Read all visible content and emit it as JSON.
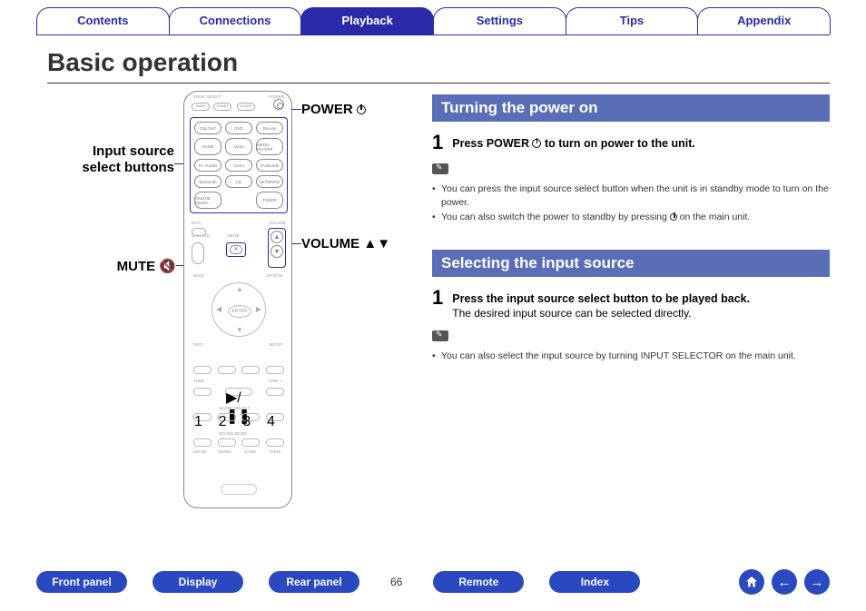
{
  "topnav": {
    "tabs": [
      {
        "label": "Contents",
        "active": false
      },
      {
        "label": "Connections",
        "active": false
      },
      {
        "label": "Playback",
        "active": true
      },
      {
        "label": "Settings",
        "active": false
      },
      {
        "label": "Tips",
        "active": false
      },
      {
        "label": "Appendix",
        "active": false
      }
    ]
  },
  "page": {
    "title": "Basic operation",
    "number": "66"
  },
  "callouts": {
    "power": "POWER",
    "input_src_line1": "Input source",
    "input_src_line2": "select buttons",
    "volume": "VOLUME",
    "mute": "MUTE"
  },
  "remote": {
    "top_labels": {
      "zone": "ZONE SELECT",
      "power": "POWER"
    },
    "top_buttons": [
      "MAIN",
      "ZONE2",
      "SLEEP"
    ],
    "source_buttons": [
      "CBL/SAT",
      "DVD",
      "Blu-ray",
      "GAME",
      "AUX1",
      "MEDIA PLAYER",
      "TV AUDIO",
      "AUX2",
      "iPod/USB",
      "Bluetooth",
      "CD",
      "NETWORK",
      "ONLINE MUSIC",
      "",
      "TUNER"
    ],
    "mid_labels": {
      "ch": "CH/PAGE",
      "mute": "MUTE",
      "volume": "VOLUME"
    },
    "mute_btn": "✕",
    "volume_up": "▲",
    "volume_down": "▼",
    "smart_select": "SMART SELECT",
    "sound_mode": "SOUND MODE"
  },
  "sections": {
    "power": {
      "heading": "Turning the power on",
      "step_num": "1",
      "step_text": "Press POWER  ⏻  to turn on power to the unit.",
      "notes": [
        "You can press the input source select button when the unit is in standby mode to turn on the power.",
        "You can also switch the power to standby by pressing ⏻ on the main unit."
      ]
    },
    "input": {
      "heading": "Selecting the input source",
      "step_num": "1",
      "step_text": "Press the input source select button to be played back.",
      "step_sub": "The desired input source can be selected directly.",
      "notes": [
        "You can also select the input source by turning INPUT SELECTOR on the main unit."
      ]
    }
  },
  "bottomnav": {
    "buttons": [
      "Front panel",
      "Display",
      "Rear panel",
      "Remote",
      "Index"
    ],
    "icons": {
      "home": "home-icon",
      "prev": "prev-icon",
      "next": "next-icon"
    }
  }
}
